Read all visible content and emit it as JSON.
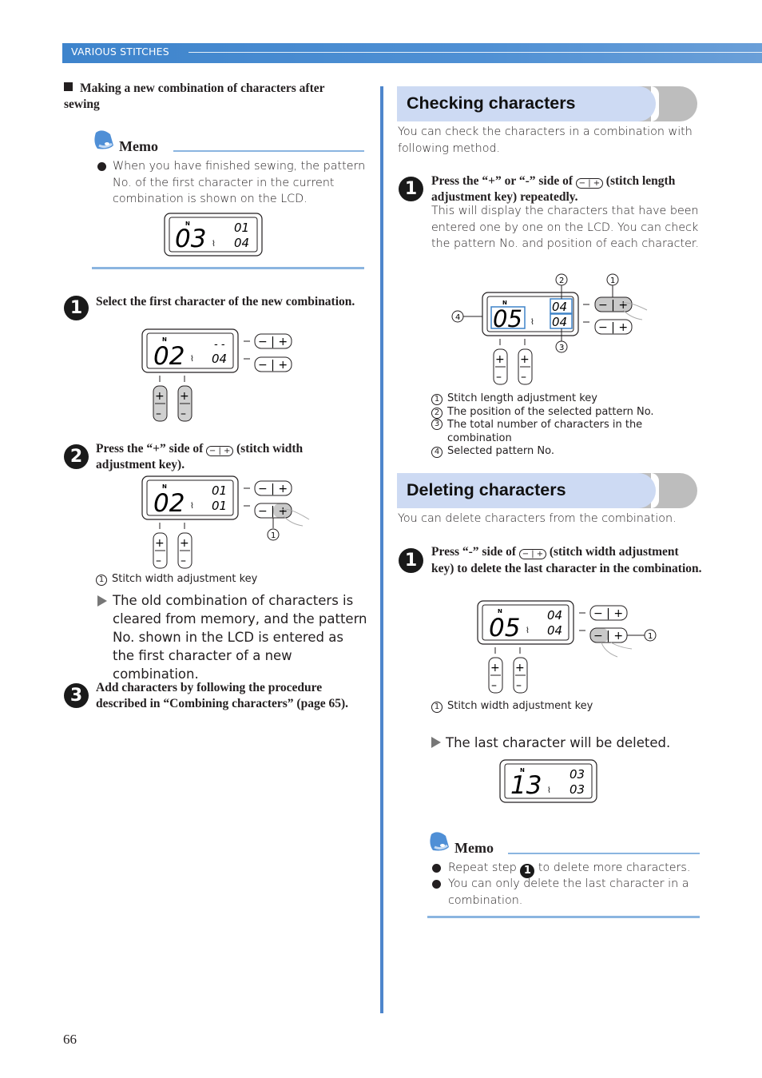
{
  "header": {
    "section": "VARIOUS STITCHES"
  },
  "left": {
    "subheading": "Making a new combination of characters after sewing",
    "memo1": {
      "title": "Memo",
      "bullets": [
        "When you have finished sewing, the pattern No. of the first character in the current combination is shown on the LCD."
      ],
      "lcd": {
        "pattern": "03",
        "position": "01",
        "total": "04"
      }
    },
    "steps": [
      {
        "num": "1",
        "text": "Select the first character of the new combination.",
        "lcd": {
          "pattern": "02",
          "position": "- -",
          "total": "04"
        }
      },
      {
        "num": "2",
        "text_before": "Press the “+” side of",
        "text_after": "(stitch width adjustment key).",
        "lcd": {
          "pattern": "02",
          "position": "01",
          "total": "01"
        },
        "callouts": [
          "Stitch width adjustment key"
        ],
        "result": "The old combination of characters is cleared from memory, and the pattern No. shown in the LCD is entered as the first character of a new combination."
      },
      {
        "num": "3",
        "text": "Add characters by following the procedure described in “Combining characters” (page 65)."
      }
    ]
  },
  "right": {
    "checking": {
      "title": "Checking characters",
      "intro": "You can check the characters in a combination with following method.",
      "step": {
        "num": "1",
        "text_before": "Press the “+” or “-” side of",
        "text_after": "(stitch length adjustment key) repeatedly.",
        "body": "This will display the characters that have been entered one by one on the LCD. You can check the pattern No. and position of each character.",
        "lcd": {
          "pattern": "05",
          "position": "04",
          "total": "04"
        },
        "callouts": [
          "Stitch length adjustment key",
          "The position of the selected pattern No.",
          "The total number of characters in the combination",
          "Selected pattern No."
        ]
      }
    },
    "deleting": {
      "title": "Deleting characters",
      "intro": "You can delete characters from the combination.",
      "step": {
        "num": "1",
        "text_before": "Press “-” side of",
        "text_after": "(stitch width adjustment key) to delete the last character in the combination.",
        "lcd": {
          "pattern": "05",
          "position": "04",
          "total": "04"
        },
        "callouts": [
          "Stitch width adjustment key"
        ],
        "result": "The last character will be deleted.",
        "result_lcd": {
          "pattern": "13",
          "position": "03",
          "total": "03"
        }
      },
      "memo": {
        "title": "Memo",
        "bullet1_before": "Repeat step",
        "bullet1_step": "1",
        "bullet1_after": "to delete more characters.",
        "bullet2": "You can only delete the last character in a combination."
      }
    }
  },
  "key_icon": {
    "minus": "−",
    "plus": "+"
  },
  "callout_nums": [
    "1",
    "2",
    "3",
    "4"
  ],
  "page_number": "66",
  "colors": {
    "header_blue": "#4a8bd2",
    "banner_blue": "#cddaf3",
    "banner_grey": "#bdbdbd",
    "memo_rule": "#8bb5e0",
    "highlight_box": "#3f83c8"
  }
}
